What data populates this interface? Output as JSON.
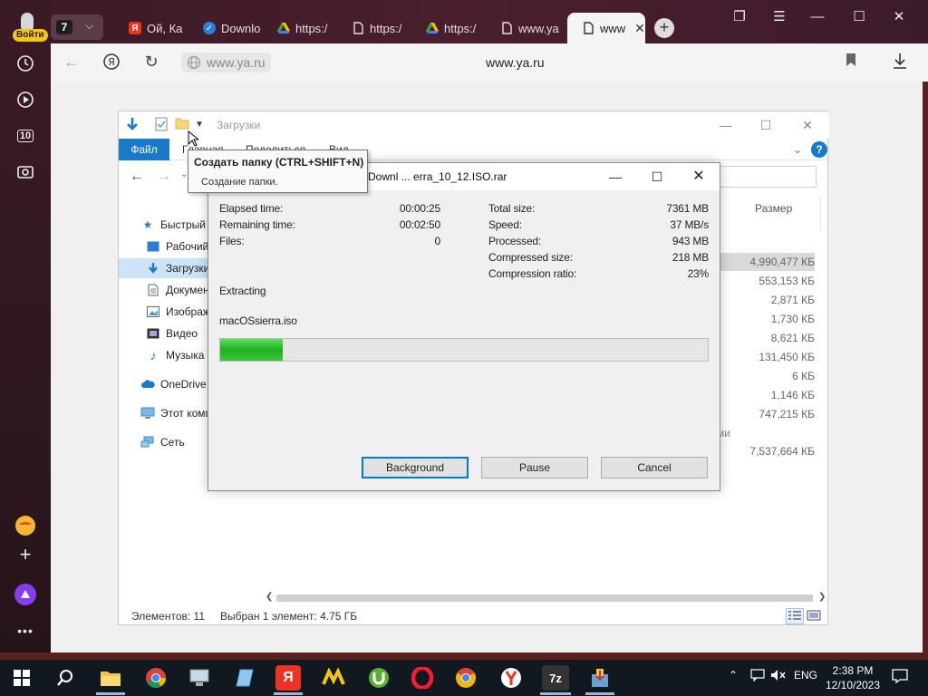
{
  "browser": {
    "login_label": "Войти",
    "tab_count": "7",
    "tabs": [
      {
        "label": "Ой, Ка",
        "icon": "yandex-icon"
      },
      {
        "label": "Downlo",
        "icon": "check-icon"
      },
      {
        "label": "https:/",
        "icon": "drive-icon"
      },
      {
        "label": "https:/",
        "icon": "page-icon"
      },
      {
        "label": "https:/",
        "icon": "drive-icon"
      },
      {
        "label": "www.ya",
        "icon": "page-icon"
      },
      {
        "label": "www",
        "icon": "page-icon"
      }
    ],
    "url_chip": "www.ya.ru",
    "url_title": "www.ya.ru",
    "rail_badge": "10"
  },
  "explorer": {
    "title": "Загрузки",
    "ribbon": {
      "file": "Файл",
      "home": "Главная",
      "share": "Поделиться",
      "view": "Вид"
    },
    "tree": [
      {
        "label": "Быстрый доступ",
        "icon": "star-icon",
        "indent": 0
      },
      {
        "label": "Рабочий стол",
        "icon": "desktop-icon",
        "indent": 1
      },
      {
        "label": "Загрузки",
        "icon": "download-icon",
        "indent": 1,
        "selected": true
      },
      {
        "label": "Документы",
        "icon": "document-icon",
        "indent": 1
      },
      {
        "label": "Изображения",
        "icon": "image-icon",
        "indent": 1
      },
      {
        "label": "Видео",
        "icon": "video-icon",
        "indent": 1
      },
      {
        "label": "Музыка",
        "icon": "music-icon",
        "indent": 1
      },
      {
        "label": "OneDrive",
        "icon": "cloud-icon",
        "indent": 0
      },
      {
        "label": "Этот компьютер",
        "icon": "computer-icon",
        "indent": 0
      },
      {
        "label": "Сеть",
        "icon": "network-icon",
        "indent": 0
      }
    ],
    "size_header": "Размер",
    "sizes": [
      "4,990,477 КБ",
      "553,153 КБ",
      "2,871 КБ",
      "1,730 КБ",
      "8,621 КБ",
      "131,450 КБ",
      "6 КБ",
      "1,146 КБ",
      "747,215 КБ",
      "",
      "7,537,664 КБ"
    ],
    "partial_text": "ми",
    "status_items": "Элементов: 11",
    "status_selected": "Выбран 1 элемент: 4.75 ГБ"
  },
  "tooltip": {
    "title": "Создать папку (CTRL+SHIFT+N)",
    "desc": "Создание папки."
  },
  "zip": {
    "title": "5\\Downl ... erra_10_12.ISO.rar",
    "left": [
      {
        "label": "Elapsed time:",
        "value": "00:00:25"
      },
      {
        "label": "Remaining time:",
        "value": "00:02:50"
      },
      {
        "label": "Files:",
        "value": "0"
      }
    ],
    "right": [
      {
        "label": "Total size:",
        "value": "7361 MB"
      },
      {
        "label": "Speed:",
        "value": "37 MB/s"
      },
      {
        "label": "Processed:",
        "value": "943 MB"
      },
      {
        "label": "Compressed size:",
        "value": "218 MB"
      },
      {
        "label": "Compression ratio:",
        "value": "23%"
      }
    ],
    "status": "Extracting",
    "file": "macOSsierra.iso",
    "progress": 0.128,
    "buttons": {
      "background": "Background",
      "pause": "Pause",
      "cancel": "Cancel"
    }
  },
  "taskbar": {
    "lang": "ENG",
    "time": "2:38 PM",
    "date": "12/10/2023",
    "zip_label": "7z"
  },
  "colors": {
    "accent": "#1979ca",
    "progress": "#22b422",
    "selection": "#cce4f7"
  }
}
